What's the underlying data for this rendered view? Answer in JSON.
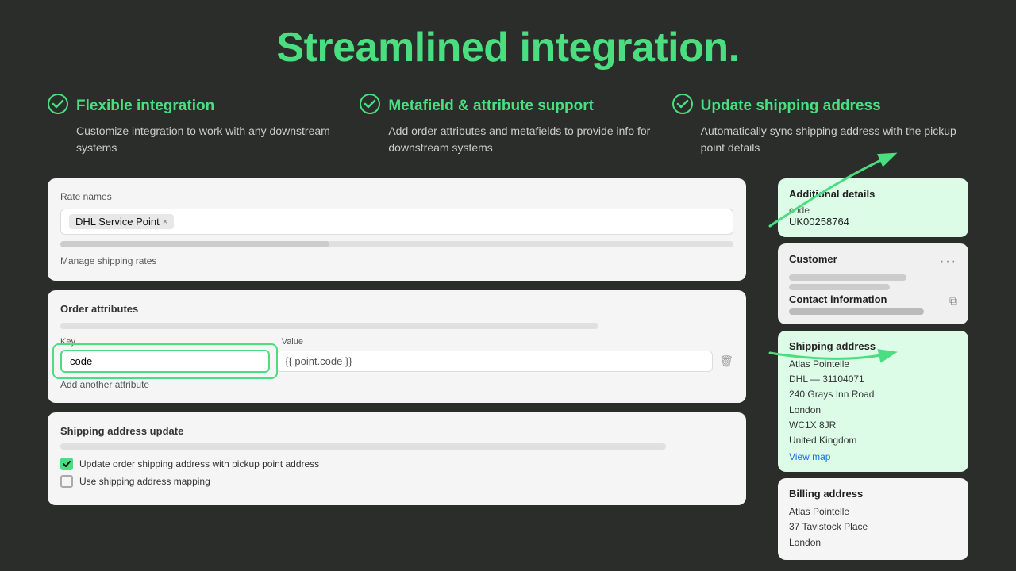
{
  "page": {
    "title": "Streamlined integration.",
    "background_color": "#2a2d2a"
  },
  "features": [
    {
      "id": "flexible",
      "title": "Flexible integration",
      "description": "Customize integration to work with any downstream systems"
    },
    {
      "id": "metafield",
      "title": "Metafield & attribute support",
      "description": "Add order attributes and metafields to provide info for downstream systems"
    },
    {
      "id": "shipping",
      "title": "Update shipping address",
      "description": "Automatically sync shipping address with the pickup point details"
    }
  ],
  "left_panel": {
    "rate_names": {
      "label": "Rate names",
      "tag": "DHL Service Point",
      "manage_link": "Manage shipping rates"
    },
    "order_attributes": {
      "label": "Order attributes",
      "key_label": "Key",
      "value_label": "Value",
      "key_value": "code",
      "value_value": "{{ point.code }}",
      "add_label": "Add another attribute"
    },
    "shipping_update": {
      "label": "Shipping address update",
      "checkbox1_label": "Update order shipping address with pickup point address",
      "checkbox2_label": "Use shipping address mapping"
    }
  },
  "right_panel": {
    "additional_details": {
      "title": "Additional details",
      "code_label": "code",
      "code_value": "UK00258764"
    },
    "customer": {
      "title": "Customer",
      "contact_title": "Contact information"
    },
    "shipping_address": {
      "title": "Shipping address",
      "lines": [
        "Atlas Pointelle",
        "DHL — 31104071",
        "240 Grays Inn Road",
        "London",
        "WC1X 8JR",
        "United Kingdom"
      ],
      "view_map": "View map"
    },
    "billing_address": {
      "title": "Billing address",
      "lines": [
        "Atlas Pointelle",
        "37 Tavistock Place",
        "London"
      ]
    }
  }
}
